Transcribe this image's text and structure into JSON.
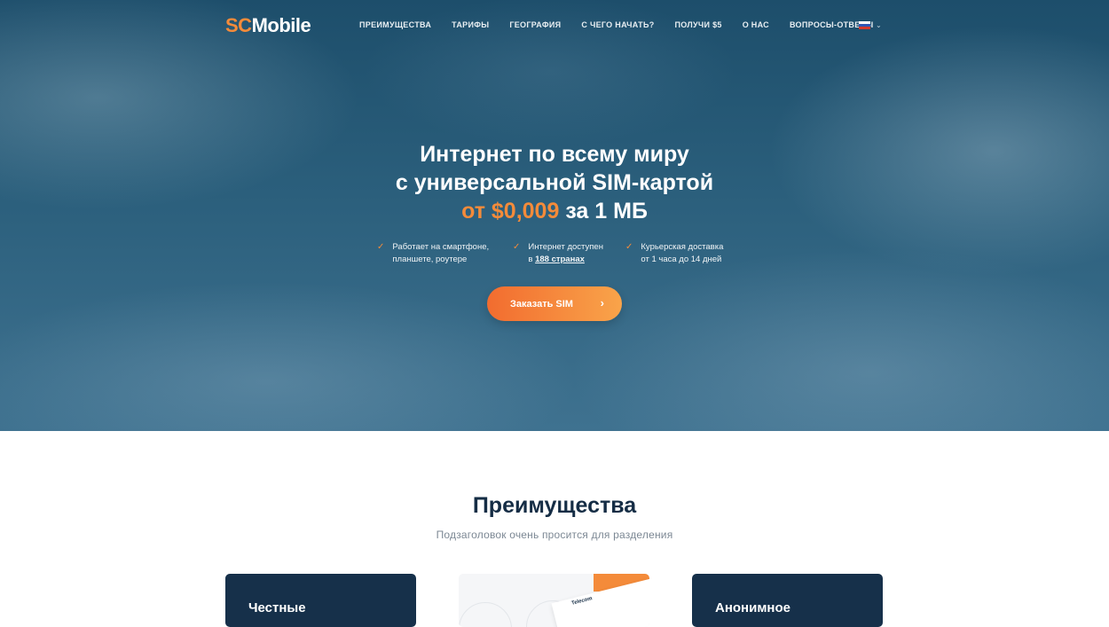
{
  "header": {
    "logo_prefix": "SC",
    "logo_suffix": "Mobile",
    "nav": [
      "ПРЕИМУЩЕСТВА",
      "ТАРИФЫ",
      "ГЕОГРАФИЯ",
      "С ЧЕГО НАЧАТЬ?",
      "ПОЛУЧИ $5",
      "О НАС",
      "ВОПРОСЫ-ОТВЕТЫ"
    ],
    "language": "russian-flag-icon"
  },
  "hero": {
    "line1": "Интернет по всему миру",
    "line2": "с универсальной SIM-картой",
    "price_highlight": "от $0,009",
    "price_rest": " за 1 МБ",
    "features": [
      {
        "line1": "Работает на смартфоне,",
        "line2": "планшете, роутере"
      },
      {
        "line1": "Интернет доступен",
        "line2_prefix": "в ",
        "line2_link": "188 странах"
      },
      {
        "line1": "Курьерская доставка",
        "line2": "от 1 часа до 14 дней"
      }
    ],
    "cta": "Заказать SIM",
    "accent": "#f48b3a"
  },
  "advantages": {
    "title": "Преимущества",
    "subtitle": "Подзаголовок очень просится для разделения",
    "cards": [
      {
        "title": "Честные"
      },
      {
        "brand": "Telecom"
      },
      {
        "title": "Анонимное"
      }
    ]
  }
}
